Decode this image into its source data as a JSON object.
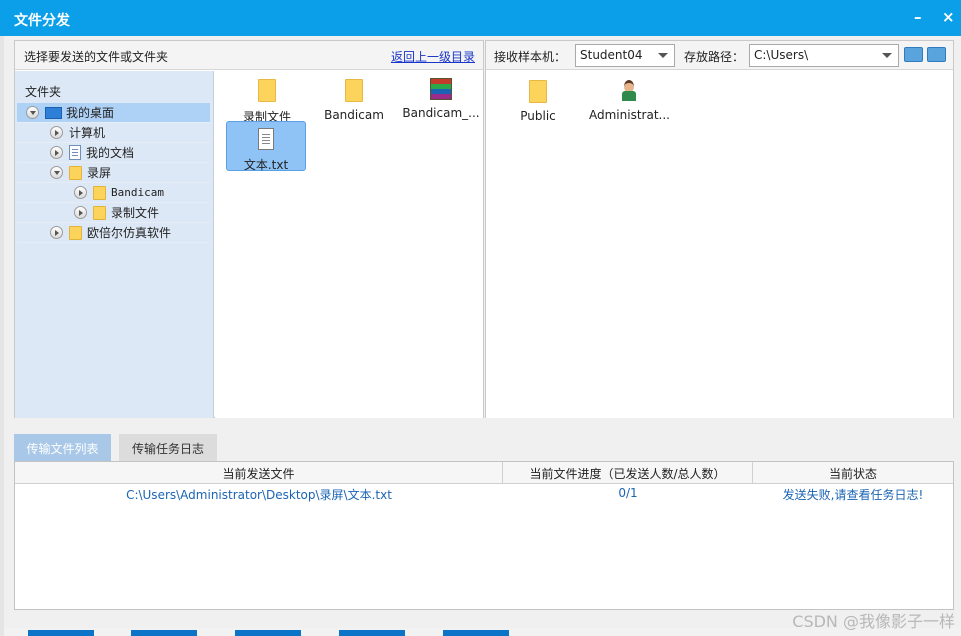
{
  "window": {
    "title": "文件分发",
    "minimize_glyph": "–",
    "close_glyph": "×"
  },
  "local": {
    "caption": "选择要发送的文件或文件夹",
    "back_link": "返回上一级目录",
    "tree_title": "文件夹",
    "tree": [
      {
        "label": "我的桌面",
        "icon": "desktop-icon",
        "expanded": true,
        "selected": true
      },
      {
        "label": "计算机",
        "icon": "",
        "expanded": false
      },
      {
        "label": "我的文档",
        "icon": "document-icon",
        "expanded": false
      },
      {
        "label": "录屏",
        "icon": "folder-icon",
        "expanded": true
      },
      {
        "label": "Bandicam",
        "icon": "folder-icon",
        "expanded": false
      },
      {
        "label": "录制文件",
        "icon": "folder-icon",
        "expanded": false
      },
      {
        "label": "欧倍尔仿真软件",
        "icon": "folder-icon",
        "expanded": false
      }
    ],
    "files": [
      {
        "name": "录制文件",
        "icon": "folder-icon"
      },
      {
        "name": "Bandicam",
        "icon": "folder-icon"
      },
      {
        "name": "Bandicam_...",
        "icon": "archive-icon"
      },
      {
        "name": "文本.txt",
        "icon": "text-file-icon",
        "selected": true
      }
    ]
  },
  "remote": {
    "receiver_label": "接收样本机：",
    "receiver_value": "Student04",
    "path_label": "存放路径：",
    "path_value": "C:\\Users\\",
    "files": [
      {
        "name": "Public",
        "icon": "folder-icon"
      },
      {
        "name": "Administrat...",
        "icon": "user-icon"
      }
    ]
  },
  "tabs": [
    {
      "label": "传输文件列表",
      "active": true
    },
    {
      "label": "传输任务日志",
      "active": false
    }
  ],
  "transfer_table": {
    "columns": [
      "当前发送文件",
      "当前文件进度（已发送人数/总人数）",
      "当前状态"
    ],
    "rows": [
      {
        "file": "C:\\Users\\Administrator\\Desktop\\录屏\\文本.txt",
        "progress": "0/1",
        "status": "发送失败,请查看任务日志!"
      }
    ]
  },
  "watermark": "CSDN @我像影子一样",
  "colors": {
    "titlebar": "#0a9fe8",
    "tree_bg": "#dde8f6",
    "selection": "#8fc3f5",
    "link": "#1a35c9",
    "row_text": "#1a64b5",
    "tab_active": "#a9c8e8"
  }
}
